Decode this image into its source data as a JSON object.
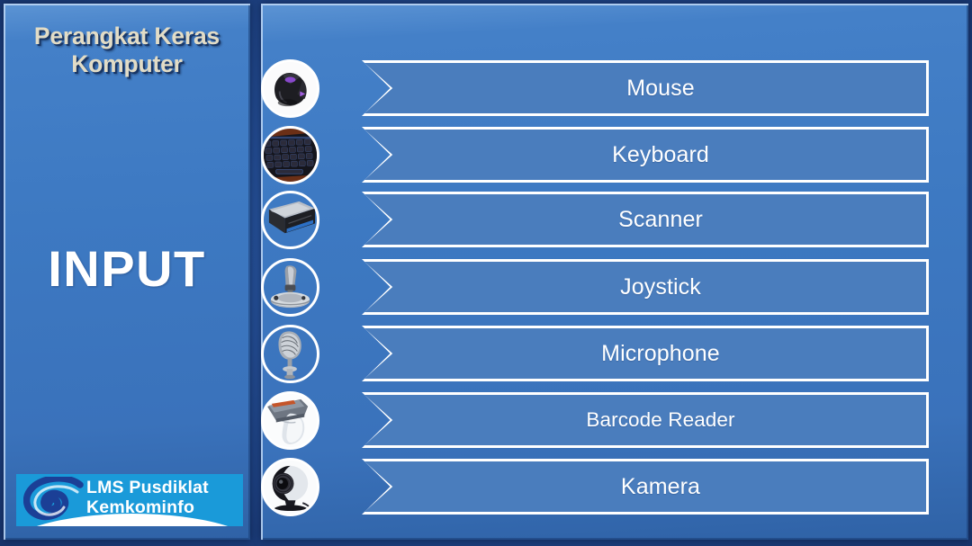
{
  "slide": {
    "title": "Perangkat Keras\nKomputer",
    "category": "INPUT",
    "title_color": "#e2dcc6",
    "panel_color": "#3d79c2",
    "bar_fill_color": "#4a7dbd",
    "bar_border_color": "#ffffff",
    "background_color": "#132a5c"
  },
  "logo": {
    "text": "LMS Pusdiklat\nKemkominfo",
    "icon": "swirl-spiral-icon",
    "background_color": "#1a9ad9",
    "text_color": "#ffffff"
  },
  "devices": [
    {
      "label": "Mouse",
      "icon": "gaming-mouse-photo",
      "thumb_style": "filled"
    },
    {
      "label": "Keyboard",
      "icon": "backlit-keyboard-photo",
      "thumb_style": "filled"
    },
    {
      "label": "Scanner",
      "icon": "flatbed-scanner-photo",
      "thumb_style": "clear"
    },
    {
      "label": "Joystick",
      "icon": "joystick-photo",
      "thumb_style": "clear"
    },
    {
      "label": "Microphone",
      "icon": "retro-microphone-photo",
      "thumb_style": "clear"
    },
    {
      "label": "Barcode Reader",
      "icon": "barcode-scanner-photo",
      "thumb_style": "filled"
    },
    {
      "label": "Kamera",
      "icon": "webcam-photo",
      "thumb_style": "filled"
    }
  ]
}
